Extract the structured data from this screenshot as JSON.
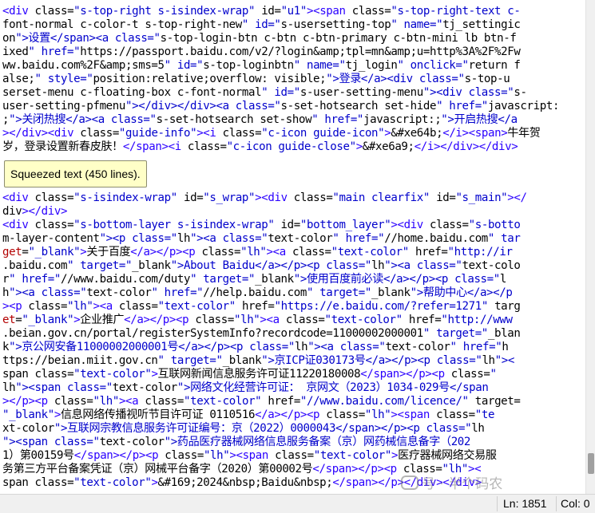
{
  "editor": {
    "code_top": [
      "<div class=\"s-top-right s-isindex-wrap\" id=\"u1\"><span class=\"s-top-right-text c-",
      "font-normal c-color-t s-top-right-new\" id=\"s-usersetting-top\" name=\"tj_settingic",
      "on\">设置</span><a class=\"s-top-login-btn c-btn c-btn-primary c-btn-mini lb btn-f",
      "ixed\" href=\"https://passport.baidu.com/v2/?login&amp;tpl=mn&amp;u=http%3A%2F%2Fw",
      "ww.baidu.com%2F&amp;sms=5\" id=\"s-top-loginbtn\" name=\"tj_login\" onclick=\"return f",
      "alse;\" style=\"position:relative;overflow: visible;\">登录</a><div class=\"s-top-u",
      "serset-menu c-floating-box c-font-normal\" id=\"s-user-setting-menu\"><div class=\"s-",
      "user-setting-pfmenu\"></div></div><a class=\"s-set-hotsearch set-hide\" href=\"javascript:",
      ";\">关闭热搜</a><a class=\"s-set-hotsearch set-show\" href=\"javascript:;\">开启热搜</a",
      "></div><div class=\"guide-info\"><i class=\"c-icon guide-icon\">&#xe64b;</i><span>牛年贺",
      "岁，登录设置新春皮肤！</span><i class=\"c-icon guide-close\">&#xe6a9;</i></div></div>"
    ],
    "squeezed_label": "Squeezed text (450 lines).",
    "code_bottom": [
      "<div class=\"s-isindex-wrap\" id=\"s_wrap\"><div class=\"main clearfix\" id=\"s_main\"></",
      "div></div>",
      "<div class=\"s-bottom-layer s-isindex-wrap\" id=\"bottom_layer\"><div class=\"s-botto",
      "m-layer-content\"><p class=\"lh\"><a class=\"text-color\" href=\"//home.baidu.com\" tar",
      "get=\"_blank\">关于百度</a></p><p class=\"lh\"><a class=\"text-color\" href=\"http://ir",
      ".baidu.com\" target=\"_blank\">About Baidu</a></p><p class=\"lh\"><a class=\"text-colo",
      "r\" href=\"//www.baidu.com/duty\" target=\"_blank\">使用百度前必读</a></p><p class=\"l",
      "h\"><a class=\"text-color\" href=\"//help.baidu.com\" target=\"_blank\">帮助中心</a></p",
      "><p class=\"lh\"><a class=\"text-color\" href=\"https://e.baidu.com/?refer=1271\" targ",
      "et=\"_blank\">企业推广</a></p><p class=\"lh\"><a class=\"text-color\" href=\"http://www",
      ".beian.gov.cn/portal/registerSystemInfo?recordcode=11000002000001\" target=\"_blan",
      "k\">京公网安备11000002000001号</a></p><p class=\"lh\"><a class=\"text-color\" href=\"h",
      "ttps://beian.miit.gov.cn\" target=\"_blank\">京ICP证030173号</a></p><p class=\"lh\"><",
      "span class=\"text-color\">互联网新闻信息服务许可证11220180008</span></p><p class=\"",
      "lh\"><span class=\"text-color\">网络文化经营许可证： 京网文（2023）1034-029号</span",
      "></p><p class=\"lh\"><a class=\"text-color\" href=\"//www.baidu.com/licence/\" target=",
      "\"_blank\">信息网络传播视听节目许可证 0110516</a></p><p class=\"lh\"><span class=\"te",
      "xt-color\">互联网宗教信息服务许可证编号：京（2022）0000043</span></p><p class=\"lh",
      "\"><span class=\"text-color\">药品医疗器械网络信息服务备案（京）网药械信息备字（202",
      "1）第00159号</span></p><p class=\"lh\"><span class=\"text-color\">医疗器械网络交易服",
      "务第三方平台备案凭证（京）网械平台备字（2020）第00002号</span></p><p class=\"lh\"><",
      "span class=\"text-color\">&#169;2024&nbsp;Baidu&nbsp;</span></p></div></div>"
    ]
  },
  "statusbar": {
    "line": "Ln: 1851",
    "col": "Col: 0"
  },
  "watermark": {
    "text": "号 · 半个码农"
  },
  "colors": {
    "tag": "#2a00ff",
    "attr": "#b30000",
    "value": "#0000cc",
    "squeezed_bg": "#ffffc7"
  }
}
